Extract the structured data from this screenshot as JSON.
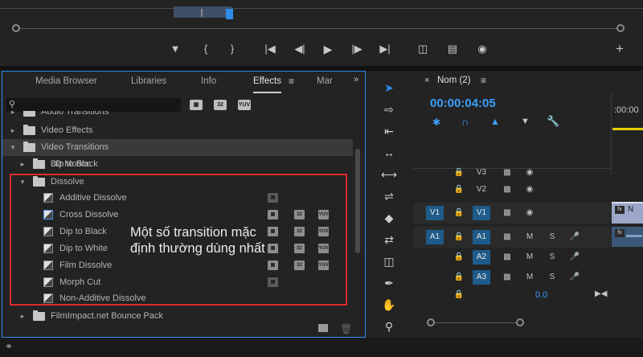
{
  "effects_panel": {
    "tabs": [
      "Media Browser",
      "Libraries",
      "Info",
      "Effects",
      "Mar"
    ],
    "active_tab": "Effects",
    "search_placeholder": "",
    "filter_chips": [
      "32",
      "YUV"
    ],
    "tree": [
      {
        "label": "Audio Transitions",
        "level": 0,
        "type": "folder",
        "partial": true
      },
      {
        "label": "Video Effects",
        "level": 0,
        "type": "folder",
        "expanded": false
      },
      {
        "label": "Video Transitions",
        "level": 0,
        "type": "folder",
        "expanded": true
      },
      {
        "label": "3D Motion",
        "level": 1,
        "type": "folder",
        "expanded": false
      },
      {
        "label": "Dip to Black",
        "level": 1,
        "type": "folder",
        "expanded": false
      },
      {
        "label": "Dissolve",
        "level": 1,
        "type": "folder",
        "expanded": true
      },
      {
        "label": "Additive Dissolve",
        "level": 2,
        "type": "effect"
      },
      {
        "label": "Cross Dissolve",
        "level": 2,
        "type": "effect"
      },
      {
        "label": "Dip to Black",
        "level": 2,
        "type": "effect"
      },
      {
        "label": "Dip to White",
        "level": 2,
        "type": "effect"
      },
      {
        "label": "Film Dissolve",
        "level": 2,
        "type": "effect"
      },
      {
        "label": "Morph Cut",
        "level": 2,
        "type": "effect"
      },
      {
        "label": "Non-Additive Dissolve",
        "level": 2,
        "type": "effect"
      },
      {
        "label": "FilmImpact.net Bounce Pack",
        "level": 0,
        "type": "folder",
        "expanded": false
      }
    ],
    "annotation": "Một số transition mặc định thường dùng nhất"
  },
  "timeline": {
    "sequence_name": "Nom (2)",
    "timecode": "00:00:04:05",
    "ruler_time": ":00:00",
    "tracks": [
      {
        "name": "V3",
        "src": ""
      },
      {
        "name": "V2",
        "src": ""
      },
      {
        "name": "V1",
        "src": "V1"
      },
      {
        "name": "A1",
        "src": "A1",
        "m": "M",
        "s": "S"
      },
      {
        "name": "A2",
        "src": "",
        "m": "M",
        "s": "S"
      },
      {
        "name": "A3",
        "src": "",
        "m": "M",
        "s": "S"
      }
    ],
    "master_value": "0.0",
    "clip_label": "N"
  },
  "colors": {
    "accent": "#2d8ceb",
    "highlight_box": "#e02b2b",
    "track_blue": "#1e5b8a",
    "timecode": "#3aa0ff"
  }
}
